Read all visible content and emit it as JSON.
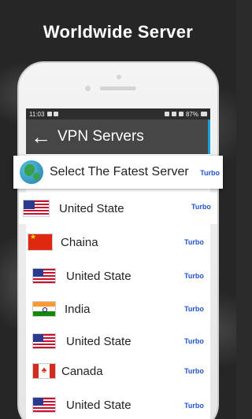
{
  "banner": {
    "title": "Worldwide Server"
  },
  "status_bar": {
    "time": "11:03",
    "battery": "87%"
  },
  "app_bar": {
    "back_icon": "arrow-left-icon",
    "title": "VPN Servers"
  },
  "best_server": {
    "icon": "globe-icon",
    "label": "Select The Fatest Server",
    "badge": "Turbo"
  },
  "servers": [
    {
      "country": "United State",
      "flag": "us-flag-icon",
      "badge": "Turbo"
    },
    {
      "country": "Chaina",
      "flag": "china-flag-icon",
      "badge": "Turbo"
    },
    {
      "country": "United State",
      "flag": "us-flag-icon",
      "badge": "Turbo"
    },
    {
      "country": "India",
      "flag": "india-flag-icon",
      "badge": "Turbo"
    },
    {
      "country": "United State",
      "flag": "us-flag-icon",
      "badge": "Turbo"
    },
    {
      "country": "Canada",
      "flag": "canada-flag-icon",
      "badge": "Turbo"
    },
    {
      "country": "United State",
      "flag": "us-flag-icon",
      "badge": "Turbo"
    }
  ],
  "colors": {
    "app_bar": "#464646",
    "badge_text": "#2255cc",
    "accent": "#1aa0d8"
  }
}
